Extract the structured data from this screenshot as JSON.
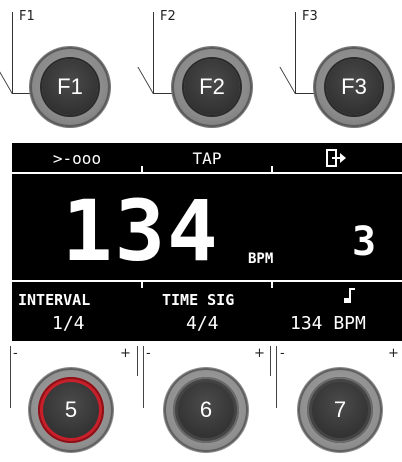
{
  "function_keys": [
    {
      "label": "F1",
      "cap": "F1"
    },
    {
      "label": "F2",
      "cap": "F2"
    },
    {
      "label": "F3",
      "cap": "F3"
    }
  ],
  "display": {
    "header": {
      "left_icon": "metronome-pattern-icon",
      "left_text": ">-ooo",
      "center": "TAP",
      "right_icon": "exit-arrow-icon"
    },
    "tempo": "134",
    "tempo_unit": "BPM",
    "side_value": "3",
    "footer": {
      "interval_label": "INTERVAL",
      "interval_value": "1/4",
      "timesig_label": "TIME SIG",
      "timesig_value": "4/4",
      "note_icon": "eighth-note-icon",
      "tempo_value": "134 BPM"
    }
  },
  "encoders": [
    {
      "number": "5",
      "minus": "-",
      "plus": "+",
      "ring_color": "#c8202a"
    },
    {
      "number": "6",
      "minus": "-",
      "plus": "+",
      "ring_color": "#444444"
    },
    {
      "number": "7",
      "minus": "-",
      "plus": "+",
      "ring_color": "#444444"
    }
  ]
}
